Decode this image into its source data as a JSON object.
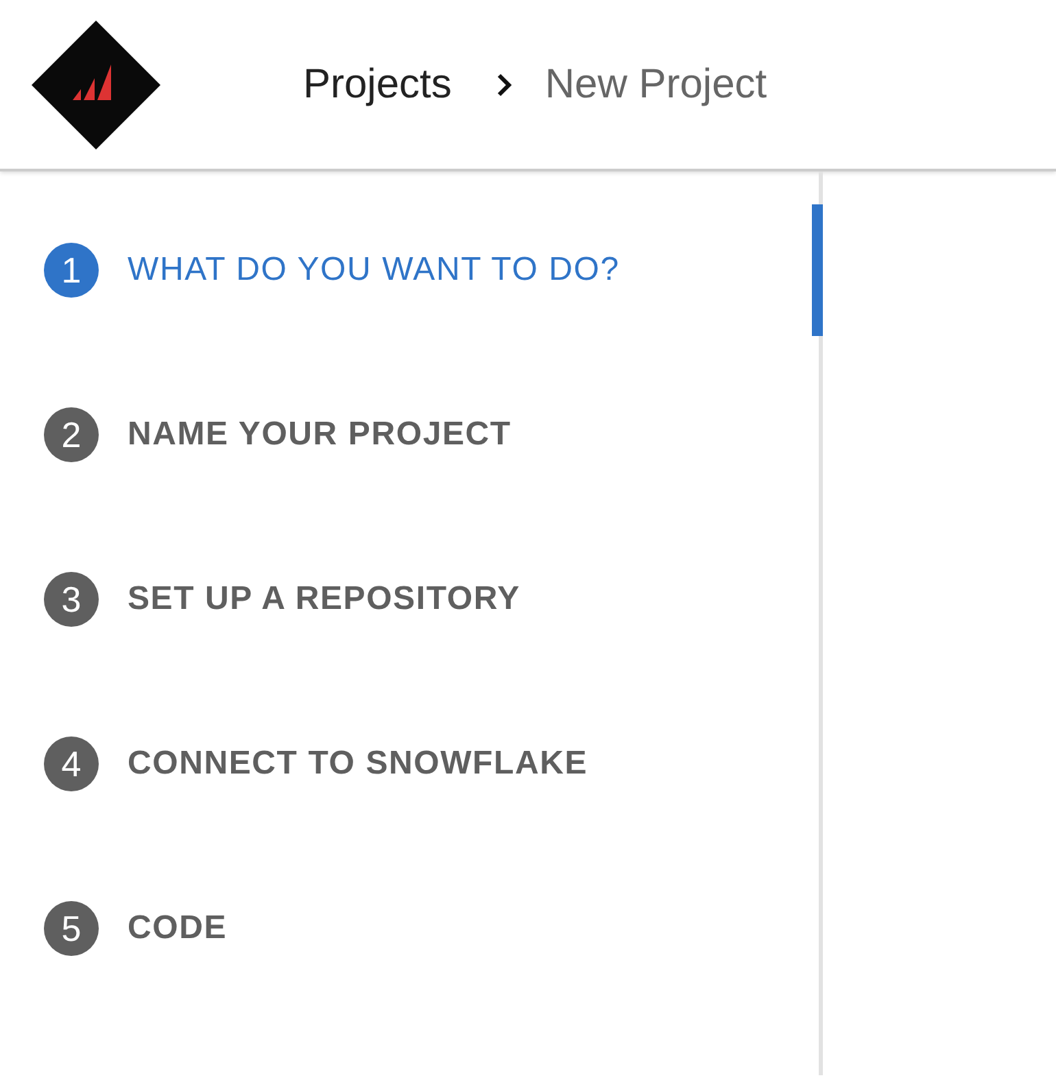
{
  "header": {
    "breadcrumb": [
      {
        "label": "Projects",
        "current": false
      },
      {
        "label": "New Project",
        "current": true
      }
    ]
  },
  "steps": [
    {
      "number": "1",
      "label": "WHAT DO YOU WANT TO DO?",
      "selected": true
    },
    {
      "number": "2",
      "label": "NAME YOUR PROJECT",
      "selected": false
    },
    {
      "number": "3",
      "label": "SET UP A REPOSITORY",
      "selected": false
    },
    {
      "number": "4",
      "label": "CONNECT TO SNOWFLAKE",
      "selected": false
    },
    {
      "number": "5",
      "label": "CODE",
      "selected": false
    }
  ]
}
